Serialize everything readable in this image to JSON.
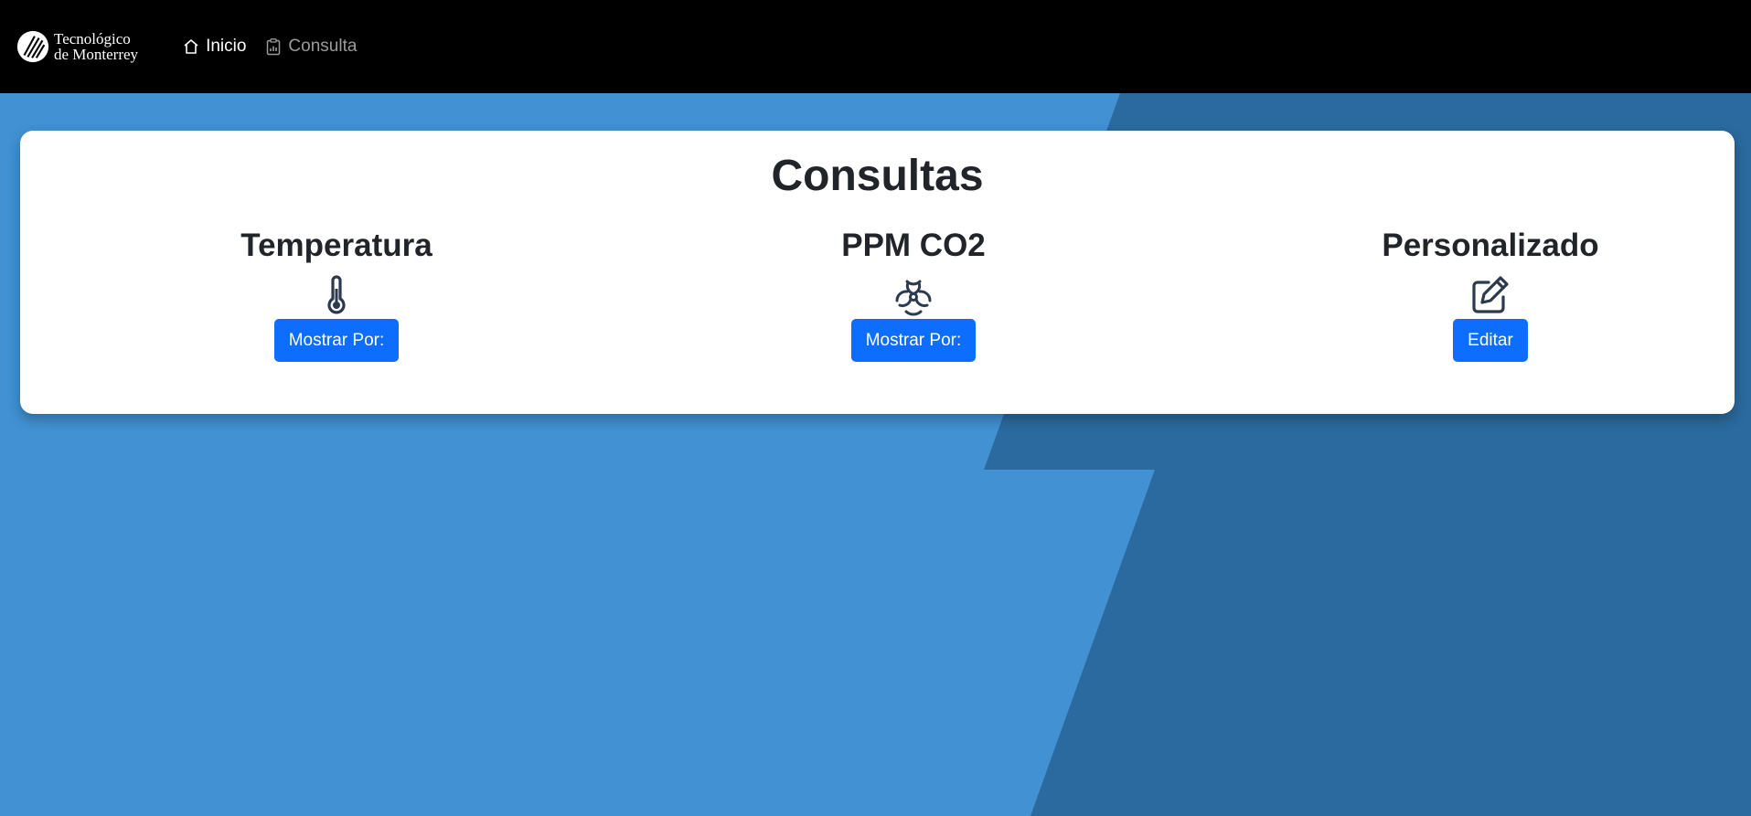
{
  "brand": {
    "line1": "Tecnológico",
    "line2": "de Monterrey",
    "logo_icon": "tec-logo-icon"
  },
  "nav": {
    "items": [
      {
        "label": "Inicio",
        "icon": "house-icon",
        "active": true
      },
      {
        "label": "Consulta",
        "icon": "clipboard-chart-icon",
        "active": false
      }
    ]
  },
  "page": {
    "title": "Consultas"
  },
  "options": [
    {
      "title": "Temperatura",
      "icon": "thermometer-icon",
      "button": "Mostrar Por:"
    },
    {
      "title": "PPM CO2",
      "icon": "biohazard-icon",
      "button": "Mostrar Por:"
    },
    {
      "title": "Personalizado",
      "icon": "pencil-square-icon",
      "button": "Editar"
    }
  ],
  "colors": {
    "navbar": "#000000",
    "background_light": "#4191d3",
    "background_dark": "#2a6a9e",
    "primary_button": "#0d6efd",
    "icon": "#2b3a4e"
  }
}
